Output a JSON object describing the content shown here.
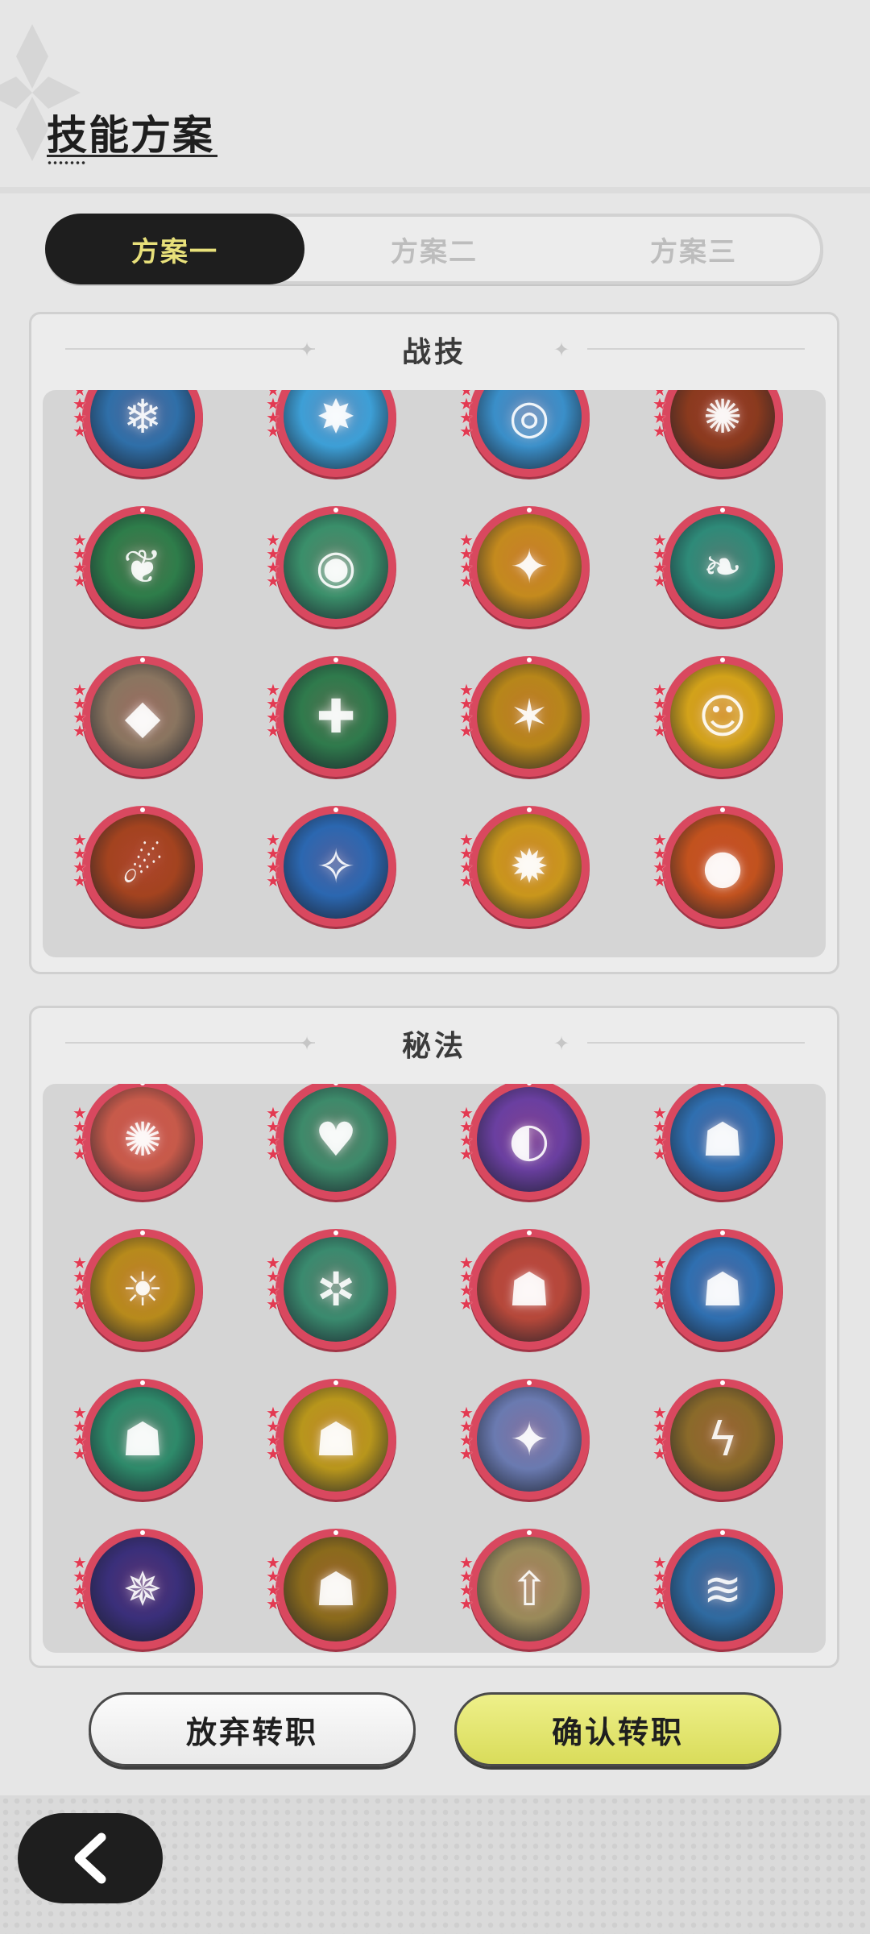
{
  "page": {
    "title": "技能方案"
  },
  "tabs": [
    {
      "label": "方案一",
      "active": true
    },
    {
      "label": "方案二",
      "active": false
    },
    {
      "label": "方案三",
      "active": false
    }
  ],
  "panels": {
    "combat": {
      "title": "战技",
      "skills": [
        {
          "icon": "ice-crystal-icon",
          "color": "#2f6fa8"
        },
        {
          "icon": "ice-burst-icon",
          "color": "#3d9fd6"
        },
        {
          "icon": "whirlwind-icon",
          "color": "#3a8fc9"
        },
        {
          "icon": "fire-swirl-icon",
          "color": "#8a3a1e"
        },
        {
          "icon": "green-flame-icon",
          "color": "#2e7d4a"
        },
        {
          "icon": "wind-orb-icon",
          "color": "#3a8f6a"
        },
        {
          "icon": "star-strike-icon",
          "color": "#c48a1e"
        },
        {
          "icon": "leaf-fan-icon",
          "color": "#2e8a78"
        },
        {
          "icon": "rock-shield-icon",
          "color": "#8a7560"
        },
        {
          "icon": "heal-cross-icon",
          "color": "#2f7a4c"
        },
        {
          "icon": "lightning-star-icon",
          "color": "#b7861a"
        },
        {
          "icon": "golden-figure-icon",
          "color": "#d2a21a"
        },
        {
          "icon": "meteor-icon",
          "color": "#a3431f"
        },
        {
          "icon": "blue-flame-icon",
          "color": "#2b67b0"
        },
        {
          "icon": "golden-burst-icon",
          "color": "#c9961c"
        },
        {
          "icon": "fireball-icon",
          "color": "#c2521e"
        }
      ]
    },
    "secret": {
      "title": "秘法",
      "skills": [
        {
          "icon": "flame-rune-icon",
          "color": "#c75a4a"
        },
        {
          "icon": "heart-rune-icon",
          "color": "#3d8a6a"
        },
        {
          "icon": "void-swirl-icon",
          "color": "#6a3fa0"
        },
        {
          "icon": "blue-figure-icon",
          "color": "#2f6fb0"
        },
        {
          "icon": "sun-burst-icon",
          "color": "#b78a1c"
        },
        {
          "icon": "jade-gear-icon",
          "color": "#3a8a6e"
        },
        {
          "icon": "crimson-figure-icon",
          "color": "#b5483a"
        },
        {
          "icon": "azure-figure-icon",
          "color": "#2f6fb0"
        },
        {
          "icon": "emerald-figure-icon",
          "color": "#2e8a6a"
        },
        {
          "icon": "gold-figure-icon",
          "color": "#b8961c"
        },
        {
          "icon": "star-shard-icon",
          "color": "#6a7ab0"
        },
        {
          "icon": "thunder-rune-icon",
          "color": "#8a6a2a"
        },
        {
          "icon": "cosmic-icon",
          "color": "#3a2f7a"
        },
        {
          "icon": "golden-aura-icon",
          "color": "#8a6a1c"
        },
        {
          "icon": "rising-light-icon",
          "color": "#9a8a5a"
        },
        {
          "icon": "wave-icon",
          "color": "#2f6aa0"
        }
      ]
    }
  },
  "buttons": {
    "cancel": "放弃转职",
    "confirm": "确认转职"
  }
}
